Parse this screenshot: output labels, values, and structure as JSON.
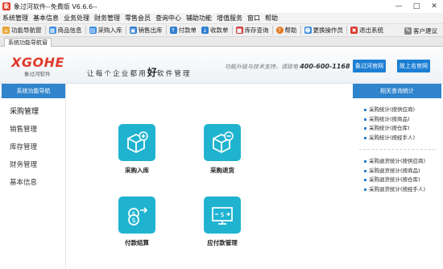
{
  "window": {
    "title": "象过河软件--免費版 V6.6.6--"
  },
  "menu": [
    "系统管理",
    "基本信息",
    "业务处理",
    "财务管理",
    "零售会员",
    "查询中心",
    "辅助功能",
    "增值服务",
    "窗口",
    "帮助"
  ],
  "toolbar": {
    "items": [
      {
        "label": "功能导航窗",
        "icon": "home-icon"
      },
      {
        "label": "商品信息",
        "icon": "grid-icon"
      },
      {
        "label": "采购入库",
        "icon": "cart-icon"
      },
      {
        "label": "销售出库",
        "icon": "box-icon"
      },
      {
        "label": "付款单",
        "icon": "pay-icon"
      },
      {
        "label": "收款单",
        "icon": "receive-icon"
      },
      {
        "label": "库存查询",
        "icon": "stock-icon"
      },
      {
        "label": "帮助",
        "icon": "help-icon"
      },
      {
        "label": "更换操作员",
        "icon": "user-switch-icon"
      },
      {
        "label": "退出系统",
        "icon": "exit-icon"
      }
    ],
    "right_label": "客户建议"
  },
  "tab": {
    "label": "系统功能导航窗"
  },
  "banner": {
    "logo_main": "XGOHE",
    "logo_sub": "象过河软件",
    "slogan_pre": "让每个企业都用",
    "slogan_big": "好",
    "slogan_post": "软件管理",
    "support_text": "功能升级与技术支持，请致电",
    "support_phone": "400-600-1168",
    "btn_official": "象过河官网",
    "btn_forum": "故上名官网"
  },
  "left_panel": {
    "title": "系统功能导航",
    "items": [
      "采购管理",
      "销售管理",
      "库存管理",
      "财务管理",
      "基本信息"
    ]
  },
  "tiles": [
    {
      "label": "采购入库",
      "icon": "purchase-in-icon"
    },
    {
      "label": "采购退货",
      "icon": "purchase-return-icon"
    },
    {
      "label": "付款结算",
      "icon": "payment-settle-icon"
    },
    {
      "label": "应付款管理",
      "icon": "payable-icon"
    }
  ],
  "right_panel": {
    "title": "相关查询统计",
    "group1": [
      "采购统计(按供应商)",
      "采购统计(按商品)",
      "采购统计(按仓库)",
      "采购统计(按经手人)"
    ],
    "group2": [
      "采购退货统计(按供应商)",
      "采购退货统计(按商品)",
      "采购退货统计(按仓库)",
      "采购退货统计(按经手人)"
    ]
  },
  "colors": {
    "accent": "#2f84cc",
    "tile": "#20b3d0",
    "brand": "#e03a2b"
  }
}
